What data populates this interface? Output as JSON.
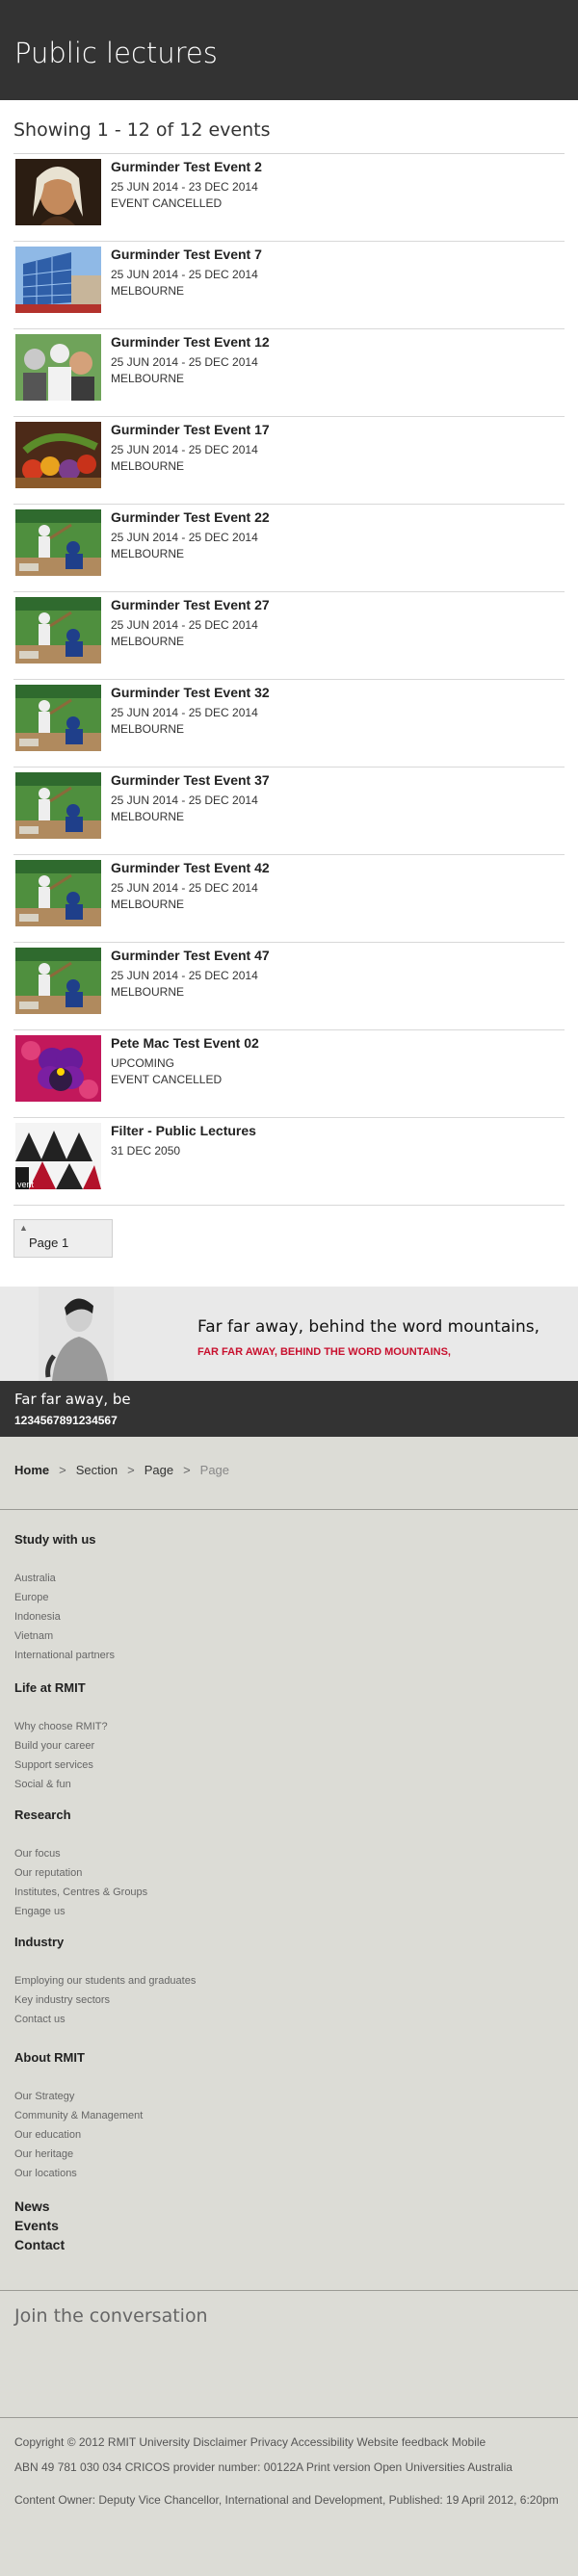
{
  "page": {
    "title": "Public lectures"
  },
  "listing": {
    "showing": "Showing 1 - 12 of 12 events"
  },
  "events": [
    {
      "title": "Gurminder Test Event 2",
      "date": "25 JUN 2014 - 23 DEC 2014",
      "status": "EVENT CANCELLED",
      "image": "portrait-painting"
    },
    {
      "title": "Gurminder Test Event 7",
      "date": "25 JUN 2014 - 25 DEC 2014",
      "status": "MELBOURNE",
      "image": "glass-building"
    },
    {
      "title": "Gurminder Test Event 12",
      "date": "25 JUN 2014 - 25 DEC 2014",
      "status": "MELBOURNE",
      "image": "people-group"
    },
    {
      "title": "Gurminder Test Event 17",
      "date": "25 JUN 2014 - 25 DEC 2014",
      "status": "MELBOURNE",
      "image": "vegetables"
    },
    {
      "title": "Gurminder Test Event 22",
      "date": "25 JUN 2014 - 25 DEC 2014",
      "status": "MELBOURNE",
      "image": "baseball"
    },
    {
      "title": "Gurminder Test Event 27",
      "date": "25 JUN 2014 - 25 DEC 2014",
      "status": "MELBOURNE",
      "image": "baseball"
    },
    {
      "title": "Gurminder Test Event 32",
      "date": "25 JUN 2014 - 25 DEC 2014",
      "status": "MELBOURNE",
      "image": "baseball"
    },
    {
      "title": "Gurminder Test Event 37",
      "date": "25 JUN 2014 - 25 DEC 2014",
      "status": "MELBOURNE",
      "image": "baseball"
    },
    {
      "title": "Gurminder Test Event 42",
      "date": "25 JUN 2014 - 25 DEC 2014",
      "status": "MELBOURNE",
      "image": "baseball"
    },
    {
      "title": "Gurminder Test Event 47",
      "date": "25 JUN 2014 - 25 DEC 2014",
      "status": "MELBOURNE",
      "image": "baseball"
    },
    {
      "title": "Pete Mac Test Event 02",
      "date": "UPCOMING",
      "status": "EVENT CANCELLED",
      "image": "pansy-flower"
    },
    {
      "title": "Filter - Public Lectures",
      "date": "31 DEC 2050",
      "status": "",
      "image": "pattern-art",
      "image_caption": "vent"
    }
  ],
  "pagination": {
    "label": "Page 1",
    "chevron": "▲"
  },
  "banner": {
    "headline": "Far far away, behind the word mountains,",
    "subline": "FAR FAR AWAY, BEHIND THE WORD MOUNTAINS,",
    "image": "man-portrait"
  },
  "strip": {
    "title": "Far far away, be",
    "number": "1234567891234567"
  },
  "breadcrumb": {
    "home": "Home",
    "sep": ">",
    "section": "Section",
    "page1": "Page",
    "current": "Page"
  },
  "footer_nav": [
    {
      "heading": "Study with us",
      "links": [
        "Australia",
        "Europe",
        "Indonesia",
        "Vietnam",
        "International partners"
      ]
    },
    {
      "heading": "Life at RMIT",
      "links": [
        "Why choose RMIT?",
        "Build your career",
        "Support services",
        "Social & fun"
      ]
    },
    {
      "heading": "Research",
      "links": [
        "Our focus",
        "Our reputation",
        "Institutes, Centres & Groups",
        "Engage us"
      ]
    },
    {
      "heading": "Industry",
      "links": [
        "Employing our students and graduates",
        "Key industry sectors",
        "Contact us"
      ]
    },
    {
      "heading": "About RMIT",
      "links": [
        "Our Strategy",
        "Community & Management",
        "Our education",
        "Our heritage",
        "Our locations"
      ]
    }
  ],
  "footer_big_links": [
    "News",
    "Events",
    "Contact"
  ],
  "join": "Join the conversation",
  "legal": {
    "line1": "Copyright © 2012 RMIT University Disclaimer Privacy Accessibility Website feedback Mobile",
    "line2": "ABN 49 781 030 034 CRICOS provider number: 00122A Print version Open Universities Australia",
    "line3": "Content Owner: Deputy Vice Chancellor, International and Development, Published: 19 April 2012, 6:20pm"
  }
}
